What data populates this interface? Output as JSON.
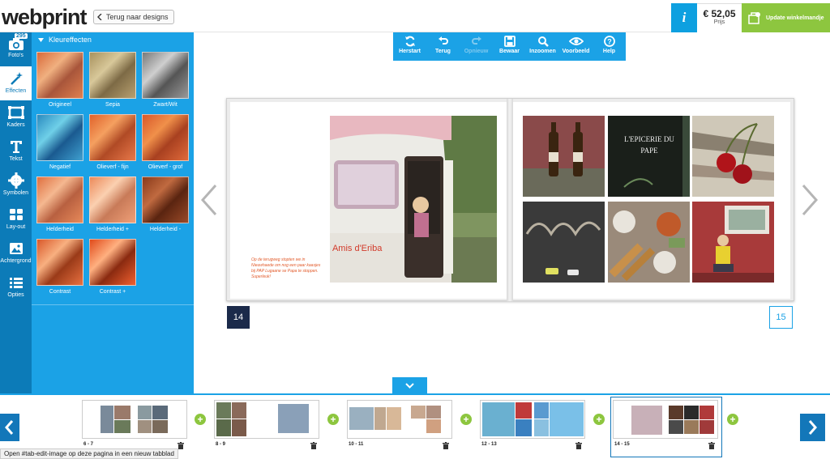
{
  "header": {
    "logo_text": "webprint",
    "back_label": "Terug naar designs",
    "info_label": "i",
    "price": "€ 52,05",
    "price_label": "Prijs",
    "cart_label": "Update winkelmandje"
  },
  "iconbar": {
    "photo_count": "295",
    "items": [
      {
        "label": "Foto's",
        "icon": "camera-icon"
      },
      {
        "label": "Effecten",
        "icon": "magic-wand-icon"
      },
      {
        "label": "Kaders",
        "icon": "frame-icon"
      },
      {
        "label": "Tekst",
        "icon": "text-icon"
      },
      {
        "label": "Symbolen",
        "icon": "gear-icon"
      },
      {
        "label": "Lay-out",
        "icon": "layout-icon"
      },
      {
        "label": "Achtergrond",
        "icon": "image-icon"
      },
      {
        "label": "Opties",
        "icon": "list-icon"
      }
    ]
  },
  "panel": {
    "title": "Kleureffecten",
    "effects": [
      {
        "label": "Origineel"
      },
      {
        "label": "Sepia"
      },
      {
        "label": "Zwart/Wit"
      },
      {
        "label": "Negatief"
      },
      {
        "label": "Olieverf - fijn"
      },
      {
        "label": "Olieverf - grof"
      },
      {
        "label": "Helderheid"
      },
      {
        "label": "Helderheid +"
      },
      {
        "label": "Helderheid -"
      },
      {
        "label": "Contrast"
      },
      {
        "label": "Contrast +"
      }
    ]
  },
  "toolbar": {
    "items": [
      {
        "label": "Herstart",
        "icon": "refresh-icon"
      },
      {
        "label": "Terug",
        "icon": "undo-icon"
      },
      {
        "label": "Opnieuw",
        "icon": "redo-icon"
      },
      {
        "label": "Bewaar",
        "icon": "save-icon"
      },
      {
        "label": "Inzoomen",
        "icon": "zoom-icon"
      },
      {
        "label": "Voorbeeld",
        "icon": "eye-icon"
      },
      {
        "label": "Help",
        "icon": "help-icon"
      }
    ]
  },
  "book": {
    "caravan_text": "s Amis d'Eriba",
    "caption": "Op de terugweg stopten we in Nieuwhaede om nog een paar kaasjes bij PAP Lugaane se Papa te stoppen. Superleuk!",
    "epicerie_text": "L'EPICERIE DU PAPE",
    "page_left": "14",
    "page_right": "15"
  },
  "filmstrip": {
    "spreads": [
      {
        "label": "6  -  7"
      },
      {
        "label": "8  -  9"
      },
      {
        "label": "10  -  11"
      },
      {
        "label": "12  -  13"
      },
      {
        "label": "14  -  15"
      }
    ],
    "add_label": "+"
  },
  "status_tip": "Open #tab-edit-image op deze pagina in een nieuw tabblad",
  "colors": {
    "accent": "#1ba2e6",
    "dark_accent": "#0c7bb8",
    "green": "#8dc63f",
    "page_number_bg": "#1b2a4a"
  }
}
